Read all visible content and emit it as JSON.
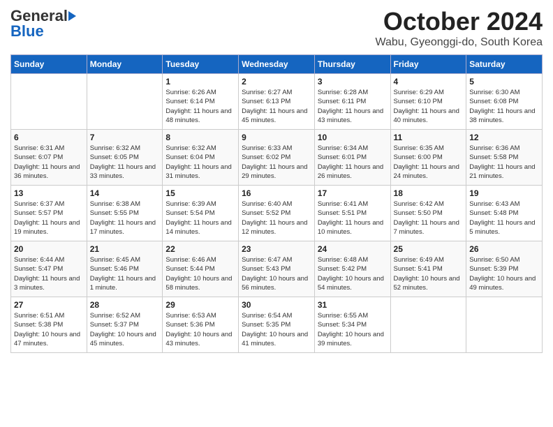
{
  "header": {
    "logo_general": "General",
    "logo_blue": "Blue",
    "title": "October 2024",
    "location": "Wabu, Gyeonggi-do, South Korea"
  },
  "days_of_week": [
    "Sunday",
    "Monday",
    "Tuesday",
    "Wednesday",
    "Thursday",
    "Friday",
    "Saturday"
  ],
  "weeks": [
    [
      {
        "num": "",
        "info": ""
      },
      {
        "num": "",
        "info": ""
      },
      {
        "num": "1",
        "info": "Sunrise: 6:26 AM\nSunset: 6:14 PM\nDaylight: 11 hours and 48 minutes."
      },
      {
        "num": "2",
        "info": "Sunrise: 6:27 AM\nSunset: 6:13 PM\nDaylight: 11 hours and 45 minutes."
      },
      {
        "num": "3",
        "info": "Sunrise: 6:28 AM\nSunset: 6:11 PM\nDaylight: 11 hours and 43 minutes."
      },
      {
        "num": "4",
        "info": "Sunrise: 6:29 AM\nSunset: 6:10 PM\nDaylight: 11 hours and 40 minutes."
      },
      {
        "num": "5",
        "info": "Sunrise: 6:30 AM\nSunset: 6:08 PM\nDaylight: 11 hours and 38 minutes."
      }
    ],
    [
      {
        "num": "6",
        "info": "Sunrise: 6:31 AM\nSunset: 6:07 PM\nDaylight: 11 hours and 36 minutes."
      },
      {
        "num": "7",
        "info": "Sunrise: 6:32 AM\nSunset: 6:05 PM\nDaylight: 11 hours and 33 minutes."
      },
      {
        "num": "8",
        "info": "Sunrise: 6:32 AM\nSunset: 6:04 PM\nDaylight: 11 hours and 31 minutes."
      },
      {
        "num": "9",
        "info": "Sunrise: 6:33 AM\nSunset: 6:02 PM\nDaylight: 11 hours and 29 minutes."
      },
      {
        "num": "10",
        "info": "Sunrise: 6:34 AM\nSunset: 6:01 PM\nDaylight: 11 hours and 26 minutes."
      },
      {
        "num": "11",
        "info": "Sunrise: 6:35 AM\nSunset: 6:00 PM\nDaylight: 11 hours and 24 minutes."
      },
      {
        "num": "12",
        "info": "Sunrise: 6:36 AM\nSunset: 5:58 PM\nDaylight: 11 hours and 21 minutes."
      }
    ],
    [
      {
        "num": "13",
        "info": "Sunrise: 6:37 AM\nSunset: 5:57 PM\nDaylight: 11 hours and 19 minutes."
      },
      {
        "num": "14",
        "info": "Sunrise: 6:38 AM\nSunset: 5:55 PM\nDaylight: 11 hours and 17 minutes."
      },
      {
        "num": "15",
        "info": "Sunrise: 6:39 AM\nSunset: 5:54 PM\nDaylight: 11 hours and 14 minutes."
      },
      {
        "num": "16",
        "info": "Sunrise: 6:40 AM\nSunset: 5:52 PM\nDaylight: 11 hours and 12 minutes."
      },
      {
        "num": "17",
        "info": "Sunrise: 6:41 AM\nSunset: 5:51 PM\nDaylight: 11 hours and 10 minutes."
      },
      {
        "num": "18",
        "info": "Sunrise: 6:42 AM\nSunset: 5:50 PM\nDaylight: 11 hours and 7 minutes."
      },
      {
        "num": "19",
        "info": "Sunrise: 6:43 AM\nSunset: 5:48 PM\nDaylight: 11 hours and 5 minutes."
      }
    ],
    [
      {
        "num": "20",
        "info": "Sunrise: 6:44 AM\nSunset: 5:47 PM\nDaylight: 11 hours and 3 minutes."
      },
      {
        "num": "21",
        "info": "Sunrise: 6:45 AM\nSunset: 5:46 PM\nDaylight: 11 hours and 1 minute."
      },
      {
        "num": "22",
        "info": "Sunrise: 6:46 AM\nSunset: 5:44 PM\nDaylight: 10 hours and 58 minutes."
      },
      {
        "num": "23",
        "info": "Sunrise: 6:47 AM\nSunset: 5:43 PM\nDaylight: 10 hours and 56 minutes."
      },
      {
        "num": "24",
        "info": "Sunrise: 6:48 AM\nSunset: 5:42 PM\nDaylight: 10 hours and 54 minutes."
      },
      {
        "num": "25",
        "info": "Sunrise: 6:49 AM\nSunset: 5:41 PM\nDaylight: 10 hours and 52 minutes."
      },
      {
        "num": "26",
        "info": "Sunrise: 6:50 AM\nSunset: 5:39 PM\nDaylight: 10 hours and 49 minutes."
      }
    ],
    [
      {
        "num": "27",
        "info": "Sunrise: 6:51 AM\nSunset: 5:38 PM\nDaylight: 10 hours and 47 minutes."
      },
      {
        "num": "28",
        "info": "Sunrise: 6:52 AM\nSunset: 5:37 PM\nDaylight: 10 hours and 45 minutes."
      },
      {
        "num": "29",
        "info": "Sunrise: 6:53 AM\nSunset: 5:36 PM\nDaylight: 10 hours and 43 minutes."
      },
      {
        "num": "30",
        "info": "Sunrise: 6:54 AM\nSunset: 5:35 PM\nDaylight: 10 hours and 41 minutes."
      },
      {
        "num": "31",
        "info": "Sunrise: 6:55 AM\nSunset: 5:34 PM\nDaylight: 10 hours and 39 minutes."
      },
      {
        "num": "",
        "info": ""
      },
      {
        "num": "",
        "info": ""
      }
    ]
  ]
}
